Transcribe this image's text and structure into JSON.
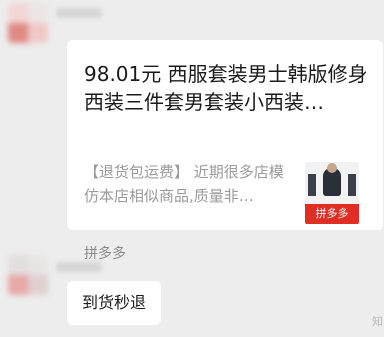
{
  "messages": [
    {
      "type": "product_card",
      "title": "98.01元 西服套装男士韩版修身西装三件套男套装小西装…",
      "description": "【退货包运费】 近期很多店模仿本店相似商品,质量非…",
      "thumbnail_badge": "拼多多",
      "footer_source": "拼多多"
    },
    {
      "type": "text",
      "text": "到货秒退"
    }
  ],
  "watermark": "知",
  "colors": {
    "background": "#ededed",
    "bubble": "#ffffff",
    "pdd_red": "#e02e24"
  }
}
